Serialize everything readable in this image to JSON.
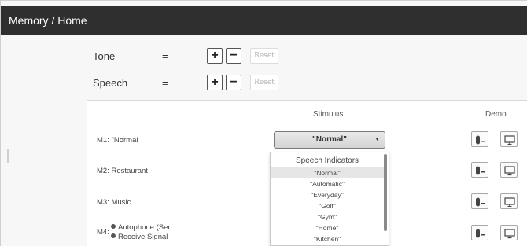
{
  "window": {
    "title": "Memory / Home"
  },
  "controls": [
    {
      "label": "Tone",
      "equals": "=",
      "plus": "+",
      "minus": "−",
      "reset": "Reset"
    },
    {
      "label": "Speech",
      "equals": "=",
      "plus": "+",
      "minus": "−",
      "reset": "Reset"
    }
  ],
  "table": {
    "headers": {
      "stimulus": "Stimulus",
      "demo": "Demo"
    },
    "rows": [
      {
        "label": "M1: \"Normal"
      },
      {
        "label": "M2: Restaurant"
      },
      {
        "label": "M3: Music"
      },
      {
        "prefix": "M4:",
        "lines": [
          "Autophone (Sen...",
          "Receive Signal"
        ]
      }
    ],
    "selected_stimulus": "\"Normal\"",
    "dropdown": {
      "header": "Speech Indicators",
      "items": [
        "\"Normal\"",
        "\"Automatic\"",
        "\"Everyday\"",
        "\"Golf\"",
        "\"Gym\"",
        "\"Home\"",
        "\"Kitchen\""
      ],
      "selected_index": 0
    }
  },
  "icons": {
    "speaker": "speaker-icon",
    "monitor": "monitor-icon",
    "caret": "caret-down-icon",
    "bullet": "bullet-dot-icon"
  }
}
